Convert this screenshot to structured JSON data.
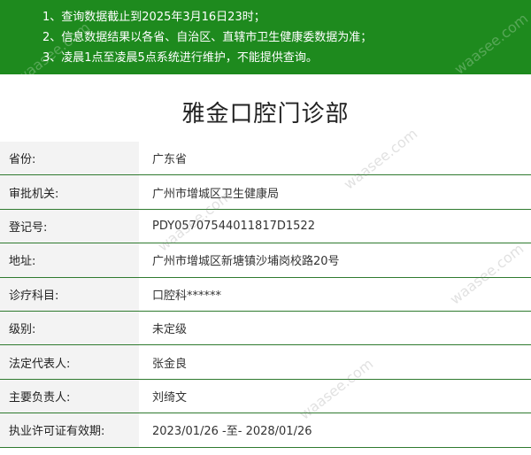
{
  "notice": {
    "lines": [
      "1、查询数据截止到2025年3月16日23时；",
      "2、信息数据结果以各省、自治区、直辖市卫生健康委数据为准；",
      "3、凌晨1点至凌晨5点系统进行维护，不能提供查询。"
    ]
  },
  "title": "雅金口腔门诊部",
  "rows": [
    {
      "label": "省份:",
      "value": "广东省"
    },
    {
      "label": "审批机关:",
      "value": "广州市增城区卫生健康局"
    },
    {
      "label": "登记号:",
      "value": "PDY05707544011817D1522"
    },
    {
      "label": "地址:",
      "value": "广州市增城区新塘镇沙埔岗校路20号"
    },
    {
      "label": "诊疗科目:",
      "value": "口腔科******"
    },
    {
      "label": "级别:",
      "value": "未定级"
    },
    {
      "label": "法定代表人:",
      "value": "张金良"
    },
    {
      "label": "主要负责人:",
      "value": "刘绮文"
    },
    {
      "label": "执业许可证有效期:",
      "value": "2023/01/26 -至- 2028/01/26"
    }
  ],
  "watermark": "waasee.com"
}
